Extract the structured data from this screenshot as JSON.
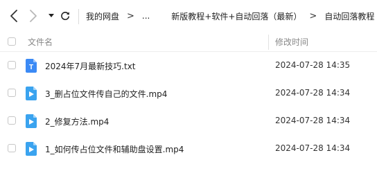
{
  "toolbar": {
    "back_icon": "chevron-left-icon",
    "forward_icon": "chevron-right-icon",
    "history_icon": "caret-down-icon",
    "refresh_icon": "refresh-icon"
  },
  "breadcrumb": {
    "items": [
      {
        "label": "我的网盘"
      },
      {
        "label": "..."
      },
      {
        "label": "新版教程+软件+自动回落（最新）"
      },
      {
        "label": "自动回落教程"
      }
    ],
    "separator": ">"
  },
  "columns": {
    "name": "文件名",
    "time": "修改时间"
  },
  "files": [
    {
      "name": "2024年7月最新技巧.txt",
      "modified": "2024-07-28 14:35",
      "type": "txt",
      "icon": "text-file-icon",
      "icon_color": "#3b8af5"
    },
    {
      "name": "3_删占位文件传自己的文件.mp4",
      "modified": "2024-07-28 14:34",
      "type": "video",
      "icon": "video-file-icon",
      "icon_color": "#3aa3ef"
    },
    {
      "name": "2_修复方法.mp4",
      "modified": "2024-07-28 14:34",
      "type": "video",
      "icon": "video-file-icon",
      "icon_color": "#3aa3ef"
    },
    {
      "name": "1_如何传占位文件和辅助盘设置.mp4",
      "modified": "2024-07-28 14:34",
      "type": "video",
      "icon": "video-file-icon",
      "icon_color": "#3aa3ef"
    }
  ]
}
